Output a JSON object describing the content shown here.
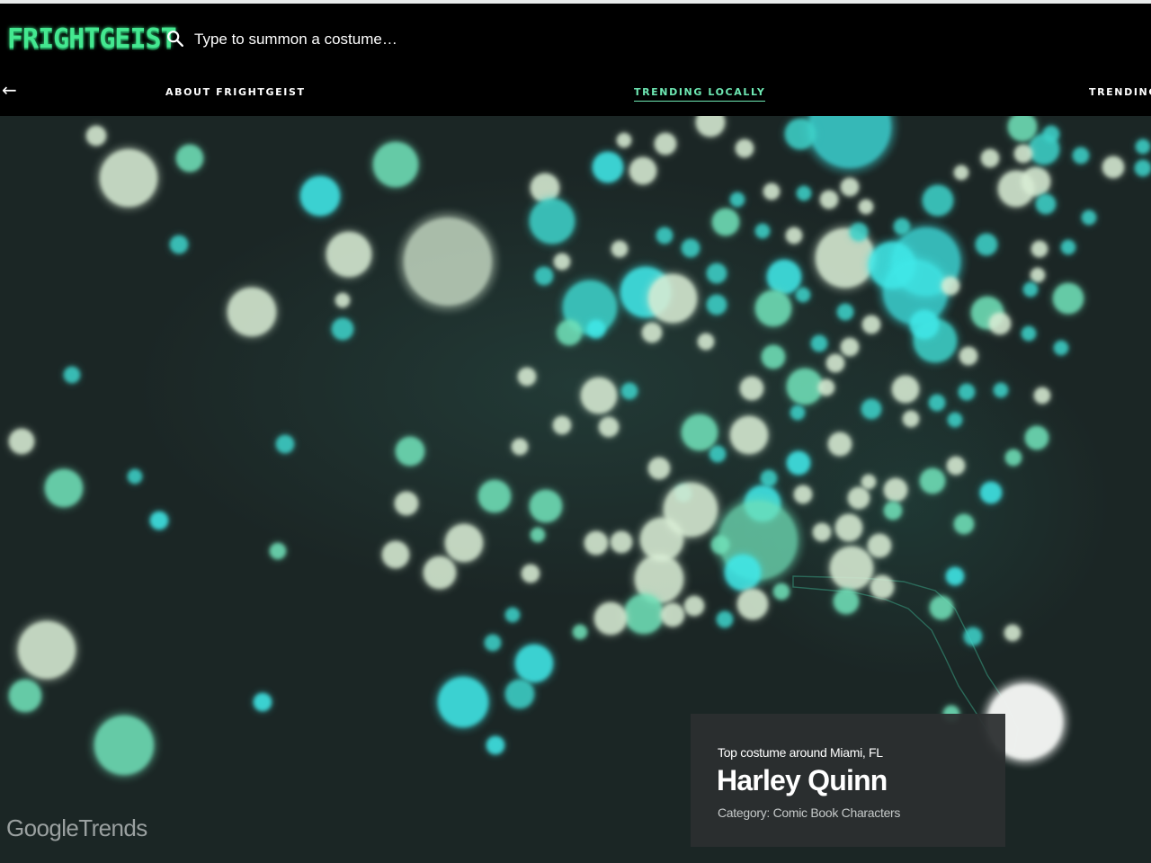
{
  "header": {
    "logo": "FRIGHTGEIST",
    "search_placeholder": "Type to summon a costume…",
    "search_icon": "search-icon"
  },
  "nav": {
    "back_icon": "arrow-left-icon",
    "back_glyph": "←",
    "items": [
      {
        "label": "ABOUT FRIGHTGEIST",
        "active": false
      },
      {
        "label": "TRENDING LOCALLY",
        "active": true
      },
      {
        "label": "TRENDING N",
        "active": false
      }
    ]
  },
  "info_card": {
    "label": "Top costume around Miami, FL",
    "costume": "Harley Quinn",
    "category": "Category: Comic Book Characters"
  },
  "branding": {
    "google": "Google",
    "trends": "Trends"
  },
  "colors": {
    "accent": "#6ee8b3",
    "logo_green": "#44e890",
    "background": "#1b2625",
    "header": "#000000",
    "bubble_pale": "#d8ecd4",
    "bubble_mint": "#6fe0b8",
    "bubble_teal": "#3ed0c8",
    "bubble_cyan": "#3fe8e8"
  }
}
